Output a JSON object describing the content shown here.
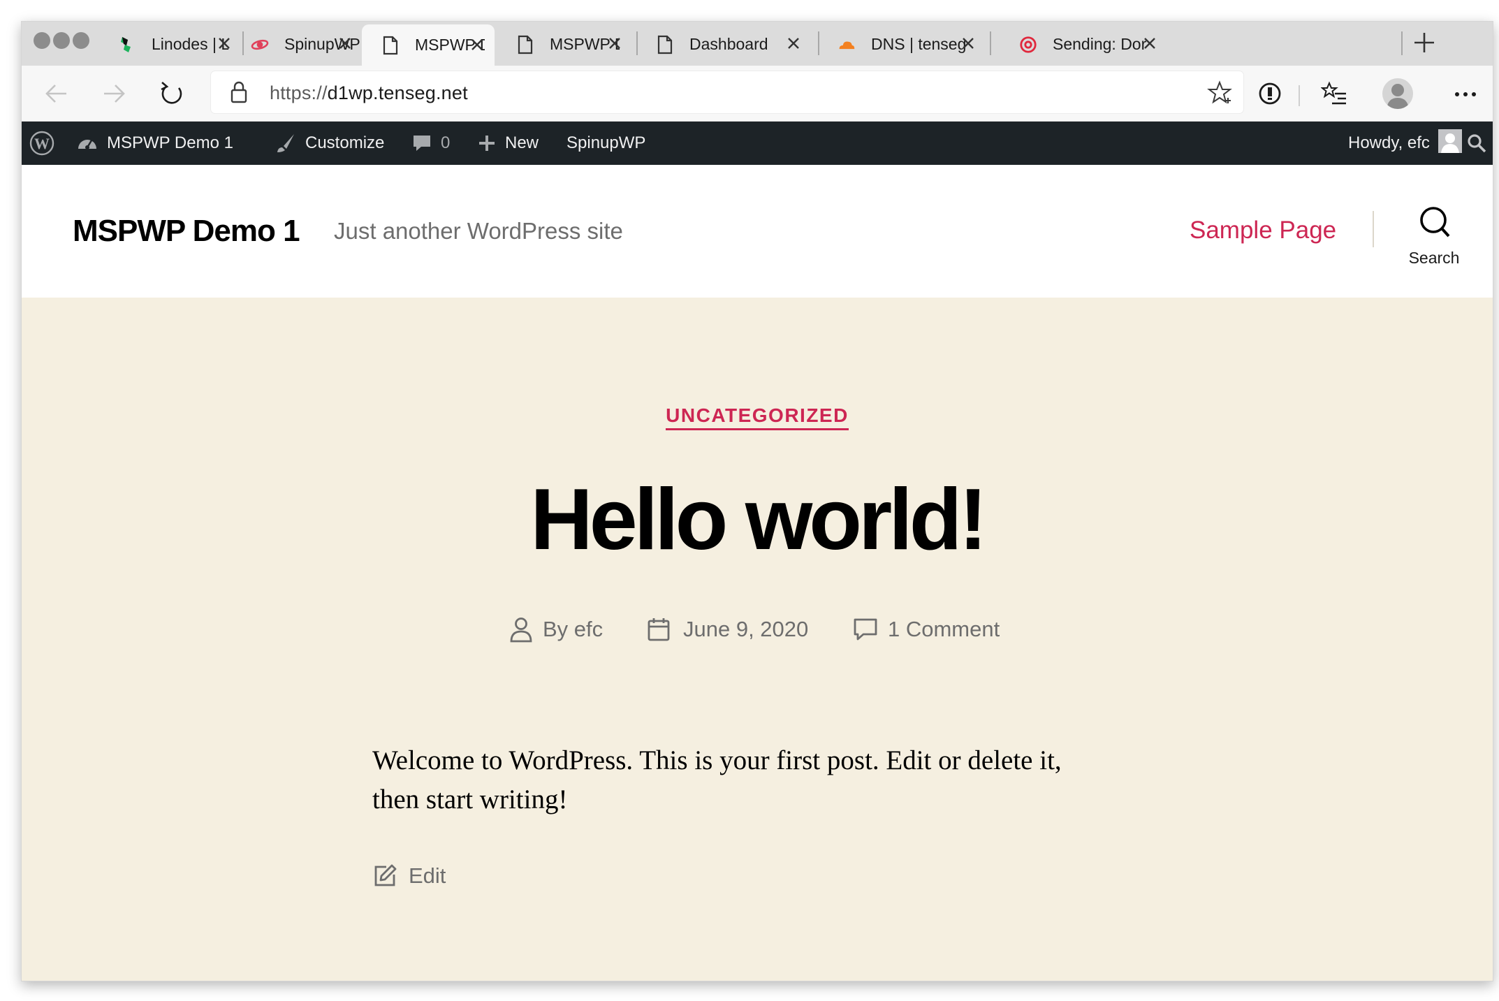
{
  "browser": {
    "tabs": [
      {
        "title": "Linodes | Lin",
        "favicon": "linode-icon"
      },
      {
        "title": "SpinupWP",
        "favicon": "spinupwp-icon"
      },
      {
        "title": "MSPWP Dem",
        "favicon": "page-icon",
        "active": true
      },
      {
        "title": "MSPWP Dem",
        "favicon": "page-icon"
      },
      {
        "title": "Dashboard",
        "favicon": "page-icon"
      },
      {
        "title": "DNS | tenseg",
        "favicon": "cloudflare-icon"
      },
      {
        "title": "Sending: Dor",
        "favicon": "mailgun-icon"
      }
    ],
    "url_protocol": "https://",
    "url_host": "d1wp.tenseg.net"
  },
  "admin_bar": {
    "site_name": "MSPWP Demo 1",
    "customize": "Customize",
    "comments_count": "0",
    "new": "New",
    "spinupwp": "SpinupWP",
    "howdy": "Howdy, efc"
  },
  "site": {
    "title": "MSPWP Demo 1",
    "tagline": "Just another WordPress site",
    "nav_item": "Sample Page",
    "search_label": "Search"
  },
  "post": {
    "category": "UNCATEGORIZED",
    "title": "Hello world!",
    "author": "By efc",
    "date": "June 9, 2020",
    "comments": "1 Comment",
    "body_line1": "Welcome to WordPress. This is your first post. Edit or delete it,",
    "body_line2": "then start writing!",
    "edit_label": "Edit"
  },
  "colors": {
    "accent": "#cd2653",
    "admin_bar_bg": "#1d2327",
    "content_bg": "#f5efe0",
    "tabstrip_bg": "#dcdcdc"
  }
}
